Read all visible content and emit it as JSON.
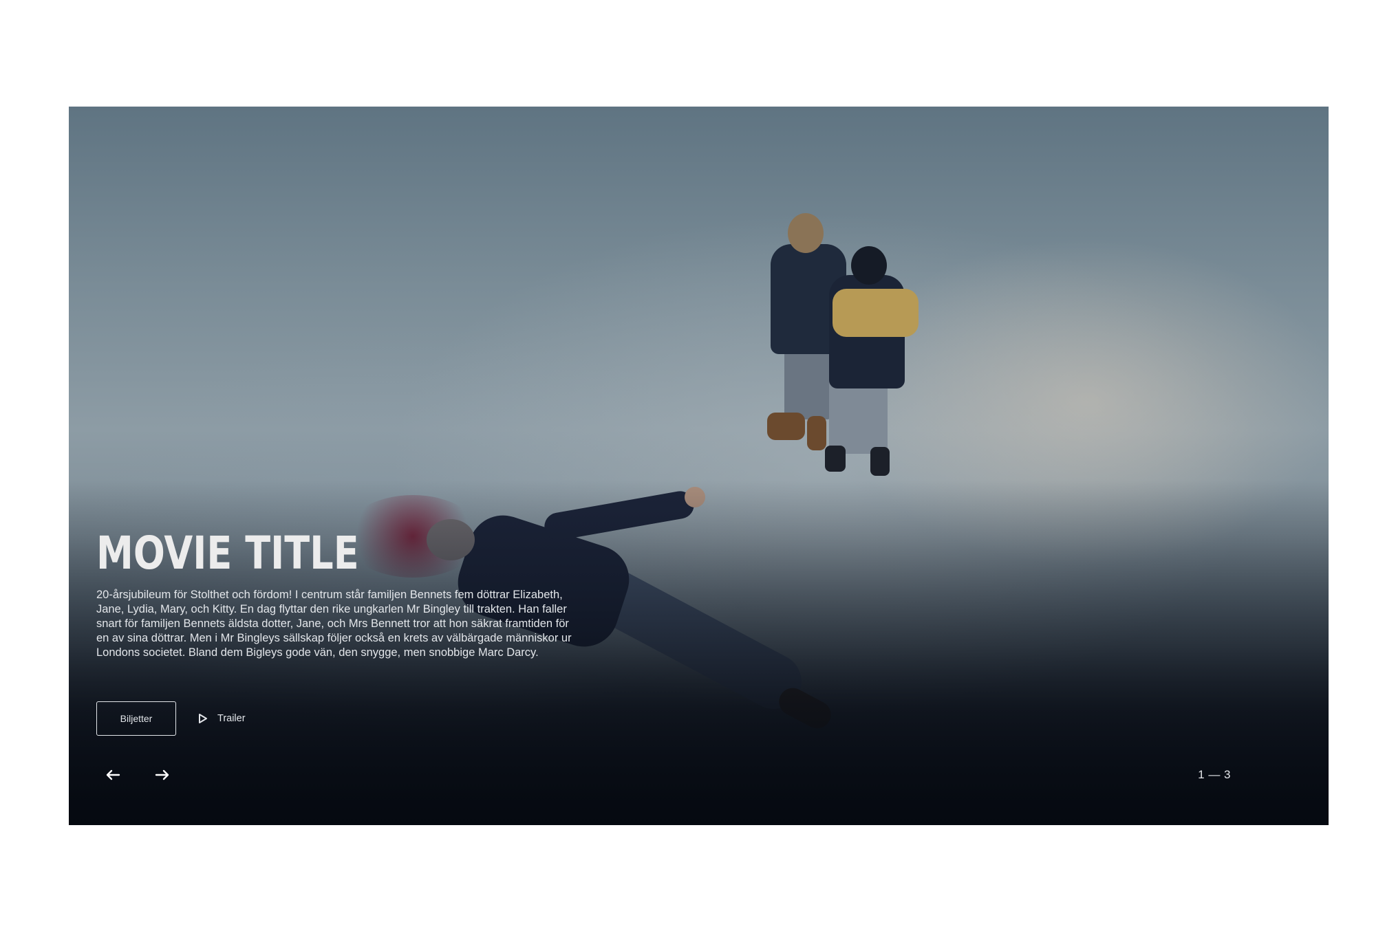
{
  "hero": {
    "title": "MOVIE TITLE",
    "description": "20-årsjubileum för Stolthet och fördom! I centrum står familjen Bennets fem döttrar Elizabeth, Jane, Lydia, Mary, och Kitty. En dag flyttar den rike ungkarlen Mr Bingley till trakten. Han faller snart för familjen Bennets äldsta dotter, Jane, och Mrs Bennett tror att hon säkrat framtiden för en av sina döttrar. Men i Mr Bingleys sällskap följer också en krets av välbärgade människor ur Londons societet. Bland dem Bigleys gode vän, den snygge, men snobbige Marc Darcy.",
    "tickets_label": "Biljetter",
    "trailer_label": "Trailer",
    "trailer_icon": "play-icon",
    "prev_icon": "arrow-left-icon",
    "next_icon": "arrow-right-icon",
    "counter": "1 — 3"
  },
  "colors": {
    "text": "#e3e6ea",
    "title": "#ececec",
    "overlay_bottom": "#05090f"
  }
}
